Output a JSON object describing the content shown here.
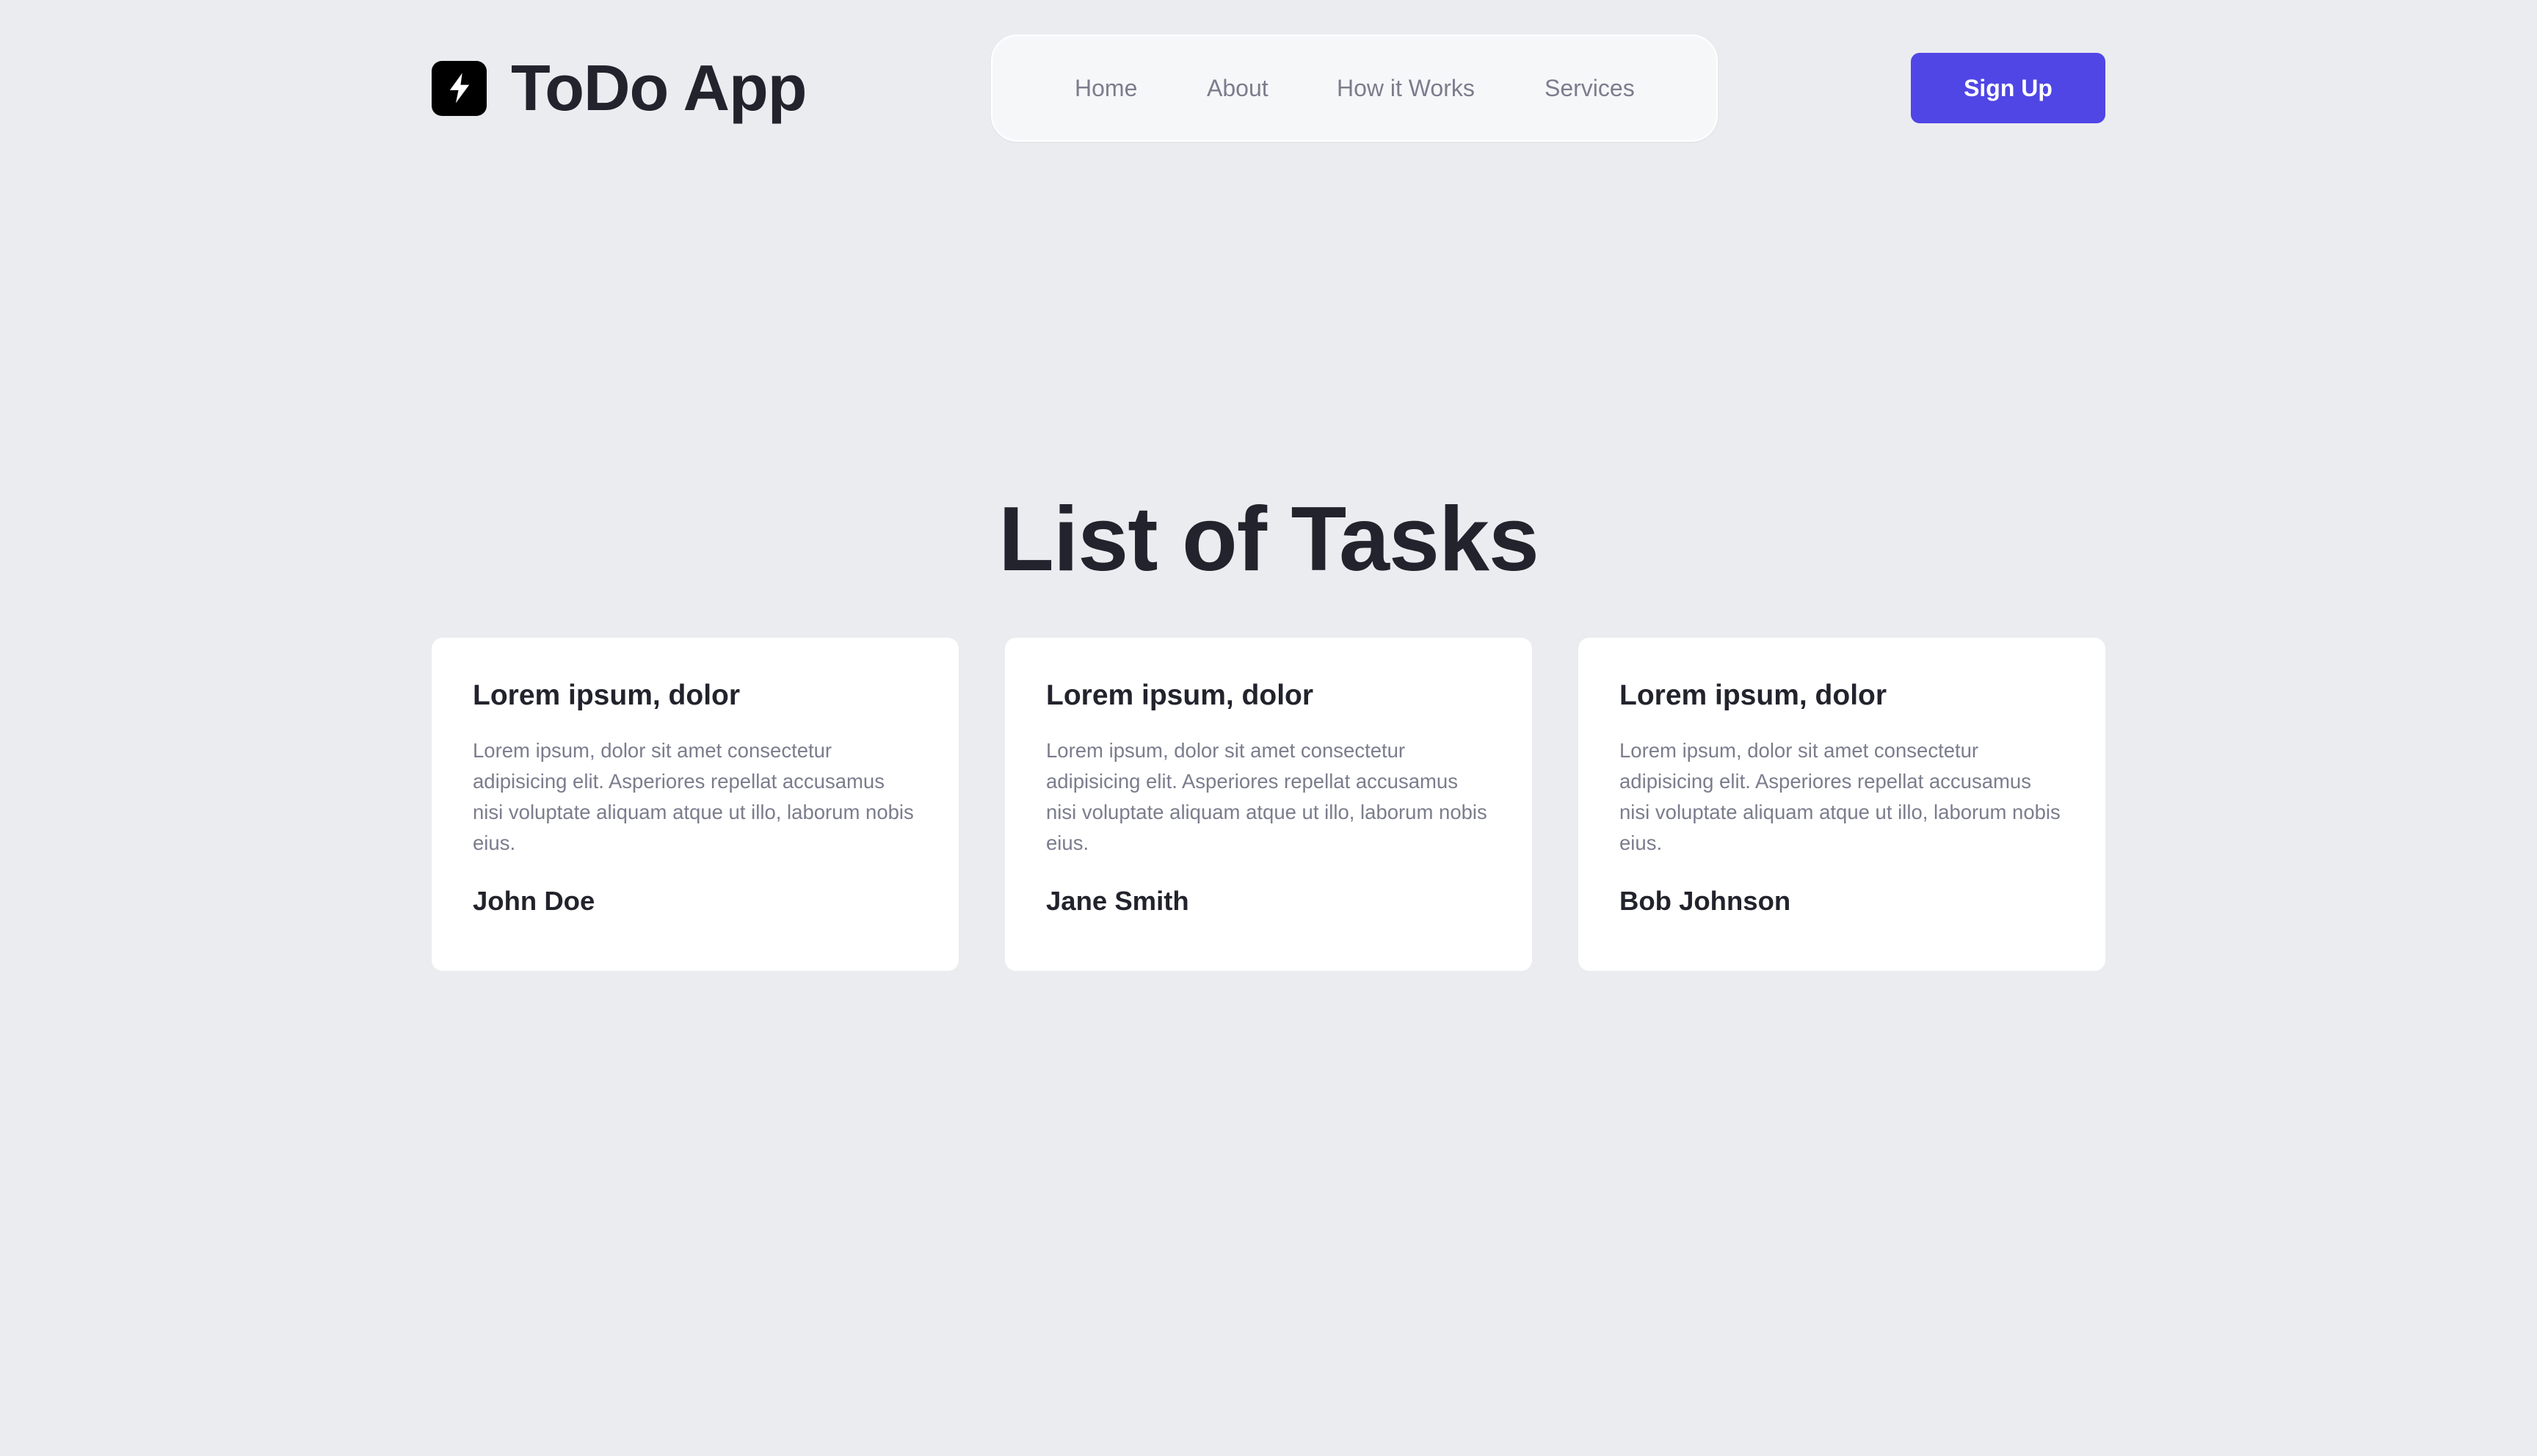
{
  "header": {
    "app_title": "ToDo App",
    "logo_icon": "lightning-bolt-icon",
    "nav": [
      {
        "label": "Home"
      },
      {
        "label": "About"
      },
      {
        "label": "How it Works"
      },
      {
        "label": "Services"
      }
    ],
    "signup_label": "Sign Up"
  },
  "main": {
    "title": "List of Tasks",
    "tasks": [
      {
        "title": "Lorem ipsum, dolor",
        "description": "Lorem ipsum, dolor sit amet consectetur adipisicing elit. Asperiores repellat accusamus nisi voluptate aliquam atque ut illo, laborum nobis eius.",
        "author": "John Doe"
      },
      {
        "title": "Lorem ipsum, dolor",
        "description": "Lorem ipsum, dolor sit amet consectetur adipisicing elit. Asperiores repellat accusamus nisi voluptate aliquam atque ut illo, laborum nobis eius.",
        "author": "Jane Smith"
      },
      {
        "title": "Lorem ipsum, dolor",
        "description": "Lorem ipsum, dolor sit amet consectetur adipisicing elit. Asperiores repellat accusamus nisi voluptate aliquam atque ut illo, laborum nobis eius.",
        "author": "Bob Johnson"
      }
    ]
  },
  "colors": {
    "background": "#EBECF0",
    "accent": "#4F46E5",
    "text_dark": "#23232D",
    "text_muted": "#7B7D8D",
    "card": "#FFFFFF"
  }
}
